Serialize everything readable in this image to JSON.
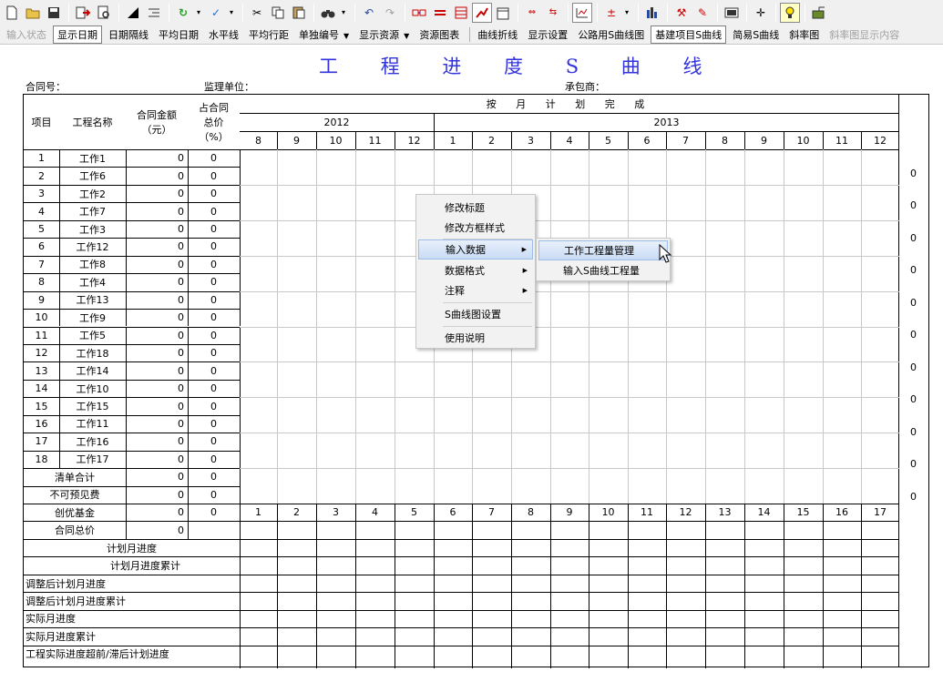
{
  "toolbar1": {
    "icons": [
      "new-file-icon",
      "open-folder-icon",
      "save-icon",
      "export-icon",
      "print-preview-icon",
      "triangle-tool-icon",
      "indent-icon",
      "refresh-icon",
      "spell-check-icon",
      "cut-icon",
      "copy-icon",
      "paste-icon",
      "binoculars-icon",
      "undo-icon",
      "redo-icon",
      "link-icon",
      "minus-red-icon",
      "table-red-icon",
      "line-chart-icon",
      "calendar-icon",
      "red-arrows-icon",
      "red-arrows-2-icon",
      "chart-check-icon",
      "align-icon",
      "bar-chart-icon",
      "tools-icon",
      "pencil-chart-icon",
      "film-icon",
      "compass-icon",
      "lightbulb-icon",
      "exit-icon"
    ]
  },
  "toolbar2": {
    "input_state": "输入状态",
    "show_date": "显示日期",
    "date_spacing": "日期隔线",
    "avg_date": "平均日期",
    "horizontal_line": "水平线",
    "avg_row_spacing": "平均行距",
    "individual_numbering": "单独编号",
    "show_resources": "显示资源",
    "resource_chart": "资源图表",
    "curve_polyline": "曲线折线",
    "display_settings": "显示设置",
    "road_s_curve": "公路用S曲线图",
    "infra_s_curve": "基建项目S曲线",
    "simple_s_curve": "简易S曲线",
    "slope_chart": "斜率图",
    "slope_display": "斜率图显示内容"
  },
  "doc": {
    "title": "工 程 进 度 S 曲 线",
    "contract_no": "合同号：",
    "supervisor": "监理单位：",
    "contractor": "承包商："
  },
  "table": {
    "headers": {
      "item": "项目",
      "name": "工程名称",
      "amount": "合同金额（元）",
      "amount_line1": "合同金额",
      "amount_line2": "（元）",
      "pct_line1": "占合同",
      "pct_line2": "总价",
      "pct_line3": "（%）",
      "monthly_plan": "按 月 计 划 完 成",
      "year_2012": "2012",
      "year_2013": "2013"
    },
    "months": [
      "8",
      "9",
      "10",
      "11",
      "12",
      "1",
      "2",
      "3",
      "4",
      "5",
      "6",
      "7",
      "8",
      "9",
      "10",
      "11",
      "12"
    ],
    "rows": [
      {
        "no": "1",
        "name": "工作1",
        "amount": "0",
        "pct": "0"
      },
      {
        "no": "2",
        "name": "工作6",
        "amount": "0",
        "pct": "0"
      },
      {
        "no": "3",
        "name": "工作2",
        "amount": "0",
        "pct": "0"
      },
      {
        "no": "4",
        "name": "工作7",
        "amount": "0",
        "pct": "0"
      },
      {
        "no": "5",
        "name": "工作3",
        "amount": "0",
        "pct": "0"
      },
      {
        "no": "6",
        "name": "工作12",
        "amount": "0",
        "pct": "0"
      },
      {
        "no": "7",
        "name": "工作8",
        "amount": "0",
        "pct": "0"
      },
      {
        "no": "8",
        "name": "工作4",
        "amount": "0",
        "pct": "0"
      },
      {
        "no": "9",
        "name": "工作13",
        "amount": "0",
        "pct": "0"
      },
      {
        "no": "10",
        "name": "工作9",
        "amount": "0",
        "pct": "0"
      },
      {
        "no": "11",
        "name": "工作5",
        "amount": "0",
        "pct": "0"
      },
      {
        "no": "12",
        "name": "工作18",
        "amount": "0",
        "pct": "0"
      },
      {
        "no": "13",
        "name": "工作14",
        "amount": "0",
        "pct": "0"
      },
      {
        "no": "14",
        "name": "工作10",
        "amount": "0",
        "pct": "0"
      },
      {
        "no": "15",
        "name": "工作15",
        "amount": "0",
        "pct": "0"
      },
      {
        "no": "16",
        "name": "工作11",
        "amount": "0",
        "pct": "0"
      },
      {
        "no": "17",
        "name": "工作16",
        "amount": "0",
        "pct": "0"
      },
      {
        "no": "18",
        "name": "工作17",
        "amount": "0",
        "pct": "0"
      }
    ],
    "bill_total": {
      "label": "清单合计",
      "amount": "0",
      "pct": "0"
    },
    "unforeseen": {
      "label": "不可预见费",
      "amount": "0",
      "pct": "0"
    },
    "excellence_fund": {
      "label": "创优基金",
      "amount": "0",
      "pct": "0"
    },
    "contract_total": {
      "label": "合同总价",
      "amount": "0"
    },
    "month_index": [
      "1",
      "2",
      "3",
      "4",
      "5",
      "6",
      "7",
      "8",
      "9",
      "10",
      "11",
      "12",
      "13",
      "14",
      "15",
      "16",
      "17"
    ],
    "progress_rows": [
      "计划月进度",
      "计划月进度累计",
      "调整后计划月进度",
      "调整后计划月进度累计",
      "实际月进度",
      "实际月进度累计",
      "工程实际进度超前/滞后计划进度"
    ],
    "right_axis": [
      "0",
      "0",
      "0",
      "0",
      "0",
      "0",
      "0",
      "0",
      "0",
      "0",
      "0"
    ]
  },
  "context_menu": {
    "edit_title": "修改标题",
    "edit_box_style": "修改方框样式",
    "input_data": "输入数据",
    "data_format": "数据格式",
    "annotation": "注释",
    "s_curve_settings": "S曲线图设置",
    "instructions": "使用说明"
  },
  "submenu": {
    "work_qty_mgmt": "工作工程量管理",
    "input_s_curve_qty": "输入S曲线工程量"
  }
}
